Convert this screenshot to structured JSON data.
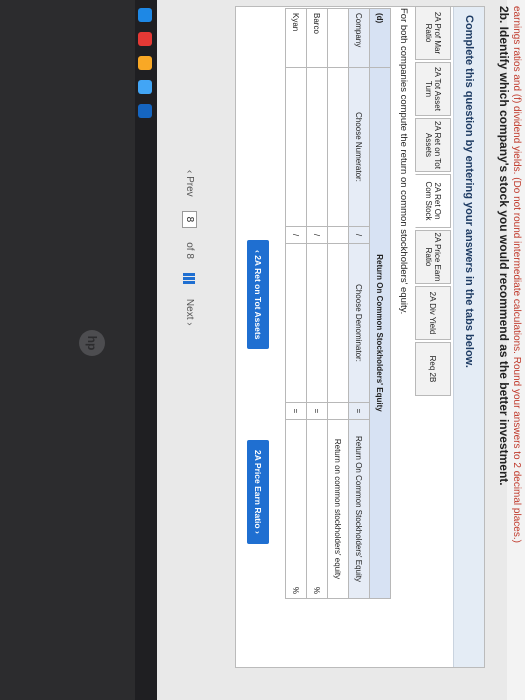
{
  "header": {
    "top_line": "earnings ratios and (f) dividend yields. (Do not round intermediate calculations. Round your answers to 2 decimal places.)",
    "question": "2b. Identify which company's stock you would recommend as the better investment."
  },
  "panel": {
    "title": "Complete this question by entering your answers in the tabs below."
  },
  "tabs": [
    {
      "label": "2A Prof Mar Ratio"
    },
    {
      "label": "2A Tot Asset Turn"
    },
    {
      "label": "2A Ret on Tot Assets"
    },
    {
      "label": "2A Ret On Com Stock"
    },
    {
      "label": "2A Price Earn Ratio"
    },
    {
      "label": "2A Div Yield"
    },
    {
      "label": "Req 2B"
    }
  ],
  "instruction": "For both companies compute the return on common stockholders' equity.",
  "table": {
    "section": "(d)",
    "title": "Return On Common Stockholders' Equity",
    "col_company": "Company",
    "col_numerator": "Choose Numerator:",
    "col_divider": "/",
    "col_denominator": "Choose Denominator:",
    "col_equals": "=",
    "col_result": "Return On Common Stockholders' Equity",
    "result_sub": "Return on common stockholders' equity",
    "rows": [
      {
        "company": "Barco",
        "slash": "/",
        "eq": "=",
        "pct": "%"
      },
      {
        "company": "Kyan",
        "slash": "/",
        "eq": "=",
        "pct": "%"
      }
    ]
  },
  "nav": {
    "prev_btn": "2A Ret on Tot Assets",
    "next_btn": "2A Price Earn Ratio"
  },
  "pager": {
    "prev": "Prev",
    "current": "8",
    "of": "of 8",
    "next": "Next"
  },
  "brand": "hp"
}
